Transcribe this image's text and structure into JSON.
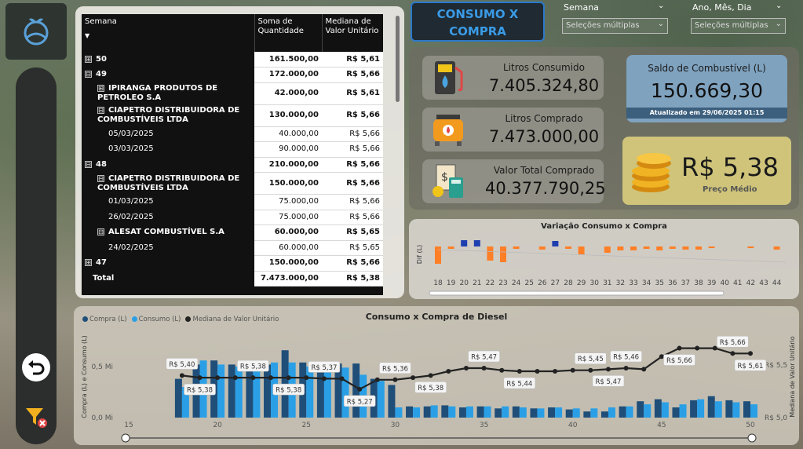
{
  "title": {
    "line1": "CONSUMO X",
    "line2": "COMPRA"
  },
  "filters": [
    {
      "label": "Semana",
      "placeholder": "Seleções múltiplas"
    },
    {
      "label": "Ano, Mês, Dia",
      "placeholder": "Seleções múltiplas"
    }
  ],
  "table": {
    "headers": [
      "Semana",
      "Soma de Quantidade",
      "Mediana de Valor Unitário"
    ],
    "rows": [
      {
        "level": 0,
        "expand": "⊞",
        "name": "50",
        "qty": "161.500,00",
        "price": "R$ 5,61"
      },
      {
        "level": 0,
        "expand": "⊟",
        "name": "49",
        "qty": "172.000,00",
        "price": "R$ 5,66"
      },
      {
        "level": 1,
        "expand": "⊞",
        "name": "IPIRANGA PRODUTOS DE PETROLEO S.A",
        "qty": "42.000,00",
        "price": "R$ 5,61"
      },
      {
        "level": 1,
        "expand": "⊟",
        "name": "CIAPETRO DISTRIBUIDORA DE COMBUSTÍVEIS LTDA",
        "qty": "130.000,00",
        "price": "R$ 5,66"
      },
      {
        "level": 2,
        "expand": "",
        "name": "05/03/2025",
        "qty": "40.000,00",
        "price": "R$ 5,66"
      },
      {
        "level": 2,
        "expand": "",
        "name": "03/03/2025",
        "qty": "90.000,00",
        "price": "R$ 5,66"
      },
      {
        "level": 0,
        "expand": "⊟",
        "name": "48",
        "qty": "210.000,00",
        "price": "R$ 5,66"
      },
      {
        "level": 1,
        "expand": "⊟",
        "name": "CIAPETRO DISTRIBUIDORA DE COMBUSTÍVEIS LTDA",
        "qty": "150.000,00",
        "price": "R$ 5,66"
      },
      {
        "level": 2,
        "expand": "",
        "name": "01/03/2025",
        "qty": "75.000,00",
        "price": "R$ 5,66"
      },
      {
        "level": 2,
        "expand": "",
        "name": "26/02/2025",
        "qty": "75.000,00",
        "price": "R$ 5,66"
      },
      {
        "level": 1,
        "expand": "⊟",
        "name": "ALESAT COMBUSTÍVEL S.A",
        "qty": "60.000,00",
        "price": "R$ 5,65"
      },
      {
        "level": 2,
        "expand": "",
        "name": "24/02/2025",
        "qty": "60.000,00",
        "price": "R$ 5,65"
      },
      {
        "level": 0,
        "expand": "⊞",
        "name": "47",
        "qty": "150.000,00",
        "price": "R$ 5,66"
      }
    ],
    "total": {
      "name": "Total",
      "qty": "7.473.000,00",
      "price": "R$ 5,38"
    }
  },
  "kpis": {
    "litros_consumido": {
      "label": "Litros Consumido",
      "value": "7.405.324,80"
    },
    "litros_comprado": {
      "label": "Litros Comprado",
      "value": "7.473.000,00"
    },
    "valor_total": {
      "label": "Valor Total Comprado",
      "value": "40.377.790,25"
    },
    "saldo": {
      "label": "Saldo de Combustível (L)",
      "value": "150.669,30",
      "updated": "Atualizado em 29/06/2025 01:15"
    },
    "preco": {
      "label": "Preço Médio",
      "value": "R$ 5,38"
    }
  },
  "colors": {
    "compra": "#1f4e79",
    "consumo": "#2a9fe6",
    "mediana": "#222222",
    "pos": "#ff7f27",
    "neg": "#1e3fb0"
  },
  "chart_data": [
    {
      "type": "bar",
      "title": "Variação Consumo x Compra",
      "ylabel": "Dif (L)",
      "categories": [
        "18",
        "19",
        "20",
        "21",
        "22",
        "23",
        "24",
        "25",
        "26",
        "27",
        "28",
        "29",
        "30",
        "31",
        "32",
        "33",
        "34",
        "35",
        "36",
        "37",
        "38",
        "39",
        "40",
        "41",
        "42",
        "43",
        "44"
      ],
      "values": [
        -22,
        -3,
        8,
        8,
        -18,
        -20,
        -3,
        0,
        -4,
        7,
        -3,
        -10,
        0,
        -8,
        -5,
        -5,
        -3,
        -5,
        -3,
        -4,
        -4,
        -2,
        0,
        0,
        -2,
        0,
        -4
      ],
      "colors_by_sign": {
        "positive": "#1e3fb0",
        "negative": "#ff7f27"
      }
    },
    {
      "type": "bar",
      "title": "Consumo x Compra de Diesel",
      "xlabel": "",
      "ylabel": "Compra (L) e Consumo (L)",
      "y2label": "Mediana de Valor Unitário",
      "x_ticks": [
        "15",
        "20",
        "25",
        "30",
        "35",
        "40",
        "45",
        "50"
      ],
      "y_ticks": [
        "0,0 Mi",
        "0,5 Mi"
      ],
      "y2_ticks": [
        "R$ 5,0",
        "R$ 5,5"
      ],
      "legend": [
        "Compra (L)",
        "Consumo (L)",
        "Mediana de Valor Unitário"
      ],
      "x": [
        18,
        19,
        20,
        21,
        22,
        23,
        24,
        25,
        26,
        27,
        28,
        29,
        30,
        31,
        32,
        33,
        34,
        35,
        36,
        37,
        38,
        39,
        40,
        41,
        42,
        43,
        44,
        45,
        46,
        47,
        48,
        49,
        50
      ],
      "series": [
        {
          "name": "Compra (L)",
          "values": [
            0.38,
            0.52,
            0.56,
            0.52,
            0.48,
            0.52,
            0.66,
            0.54,
            0.48,
            0.53,
            0.53,
            0.38,
            0.32,
            0.11,
            0.11,
            0.12,
            0.1,
            0.11,
            0.09,
            0.11,
            0.09,
            0.1,
            0.08,
            0.06,
            0.06,
            0.11,
            0.16,
            0.18,
            0.1,
            0.17,
            0.21,
            0.17,
            0.16
          ]
        },
        {
          "name": "Consumo (L)",
          "values": [
            0.3,
            0.56,
            0.52,
            0.5,
            0.53,
            0.54,
            0.54,
            0.5,
            0.53,
            0.49,
            0.42,
            0.36,
            0.1,
            0.1,
            0.12,
            0.11,
            0.11,
            0.11,
            0.11,
            0.1,
            0.09,
            0.1,
            0.09,
            0.09,
            0.1,
            0.11,
            0.13,
            0.15,
            0.13,
            0.18,
            0.16,
            0.15,
            0.13
          ]
        },
        {
          "name": "Mediana de Valor Unitário",
          "values": [
            5.4,
            5.38,
            5.38,
            5.38,
            5.38,
            5.38,
            5.38,
            5.38,
            5.37,
            5.37,
            5.27,
            5.36,
            5.36,
            5.38,
            5.4,
            5.44,
            5.47,
            5.47,
            5.45,
            5.44,
            5.44,
            5.44,
            5.45,
            5.45,
            5.46,
            5.47,
            5.46,
            5.58,
            5.66,
            5.66,
            5.66,
            5.61,
            5.61
          ]
        }
      ],
      "labels": [
        {
          "x": 18,
          "text": "R$ 5,40"
        },
        {
          "x": 19,
          "text": "R$ 5,38"
        },
        {
          "x": 22,
          "text": "R$ 5,38"
        },
        {
          "x": 24,
          "text": "R$ 5,38"
        },
        {
          "x": 26,
          "text": "R$ 5,37"
        },
        {
          "x": 28,
          "text": "R$ 5,27"
        },
        {
          "x": 30,
          "text": "R$ 5,36"
        },
        {
          "x": 32,
          "text": "R$ 5,38"
        },
        {
          "x": 35,
          "text": "R$ 5,47"
        },
        {
          "x": 37,
          "text": "R$ 5,44"
        },
        {
          "x": 41,
          "text": "R$ 5,45"
        },
        {
          "x": 42,
          "text": "R$ 5,47"
        },
        {
          "x": 43,
          "text": "R$ 5,46"
        },
        {
          "x": 46,
          "text": "R$ 5,66"
        },
        {
          "x": 49,
          "text": "R$ 5,66"
        },
        {
          "x": 50,
          "text": "R$ 5,61"
        }
      ]
    }
  ]
}
